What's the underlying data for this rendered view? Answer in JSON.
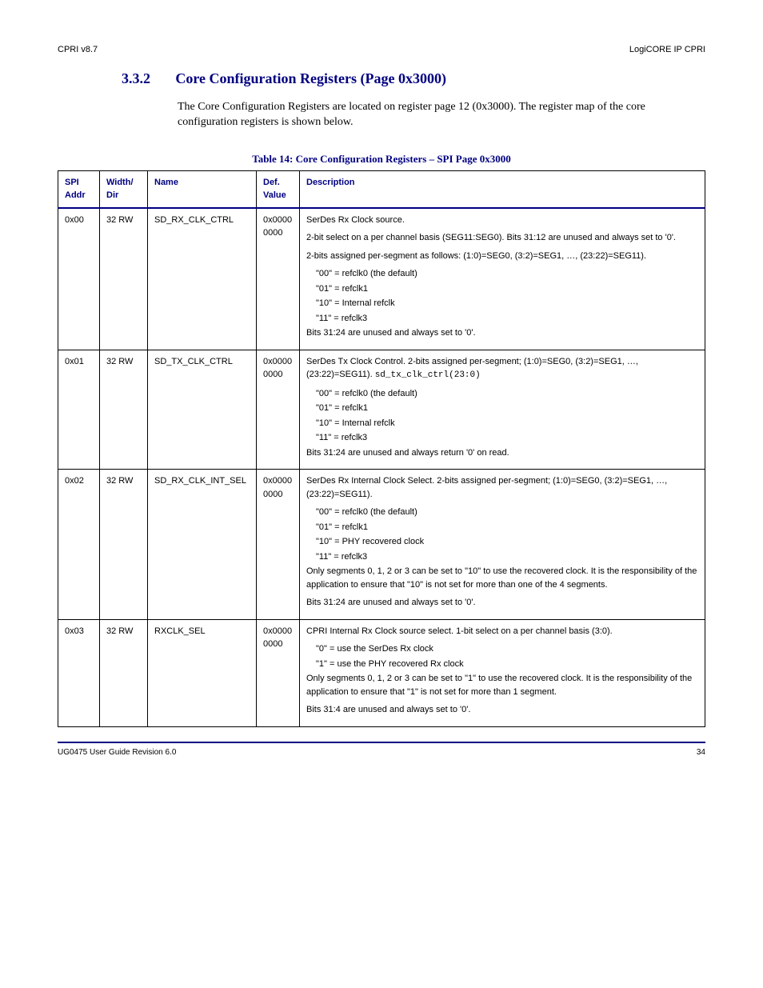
{
  "header": {
    "left": "CPRI v8.7",
    "right": "LogiCORE IP CPRI"
  },
  "section": {
    "number": "3.3.2",
    "title": "Core Configuration Registers (Page 0x3000)"
  },
  "intro": "The Core Configuration Registers are located on register page 12 (0x3000). The register map of the core configuration registers is shown below.",
  "table_title": "Table 14: Core Configuration Registers – SPI Page 0x3000",
  "cols": {
    "c0": "SPI Addr",
    "c1": "Width/ Dir",
    "c2": "Name",
    "c3": "Def. Value",
    "c4": "Description"
  },
  "rows": [
    {
      "addr": "0x00",
      "wd": "32 RW",
      "name": "SD_RX_CLK_CTRL",
      "def": "0x0000 0000",
      "desc": [
        "SerDes Rx Clock source.",
        "2-bit select on a per channel basis (SEG11:SEG0). Bits 31:12 are unused and always set to '0'.",
        "2-bits assigned per-segment as follows: (1:0)=SEG0, (3:2)=SEG1, …, (23:22)=SEG11).",
        "{li}\"00\" = refclk0 (the default)",
        "{li}\"01\" = refclk1",
        "{li}\"10\" = Internal refclk",
        "{li}\"11\" = refclk3",
        "Bits 31:24 are unused and always set to '0'."
      ]
    },
    {
      "addr": "0x01",
      "wd": "32 RW",
      "name": "SD_TX_CLK_CTRL",
      "def": "0x0000 0000",
      "desc": [
        "SerDes Tx Clock Control.  2-bits assigned per-segment; (1:0)=SEG0, (3:2)=SEG1, …, (23:22)=SEG11). sd_tx_clk_ctrl(23:0)",
        "{li}\"00\" = refclk0 (the default)",
        "{li}\"01\" = refclk1",
        "{li}\"10\" = Internal refclk",
        "{li}\"11\" = refclk3",
        "Bits 31:24 are unused and always return '0' on read."
      ]
    },
    {
      "addr": "0x02",
      "wd": "32 RW",
      "name": "SD_RX_CLK_INT_SEL",
      "def": "0x0000 0000",
      "desc": [
        "SerDes Rx Internal Clock Select.  2-bits assigned per-segment; (1:0)=SEG0, (3:2)=SEG1, …, (23:22)=SEG11).",
        "{li}\"00\" = refclk0 (the default)",
        "{li}\"01\" = refclk1",
        "{li}\"10\" = PHY recovered clock",
        "{li}\"11\" = refclk3",
        "Only segments 0, 1, 2 or 3 can be set to \"10\" to use the recovered clock. It is the responsibility of the application to ensure that \"10\" is not set for more than one of the 4 segments.",
        "Bits 31:24 are unused and always set to '0'."
      ]
    },
    {
      "addr": "0x03",
      "wd": "32 RW",
      "name": "RXCLK_SEL",
      "def": "0x0000 0000",
      "desc": [
        "CPRI Internal Rx Clock source select. 1-bit select on a per channel basis (3:0).",
        "{li}\"0\" = use the SerDes Rx clock",
        "{li}\"1\" = use the PHY recovered Rx clock",
        "Only segments 0, 1, 2 or 3 can be set to \"1\" to use the recovered clock. It is the responsibility of the application to ensure that \"1\" is not set for more than 1 segment.",
        "Bits 31:4 are unused and always set to '0'."
      ]
    }
  ],
  "footer": {
    "left": "UG0475 User Guide Revision 6.0",
    "right": "34"
  }
}
